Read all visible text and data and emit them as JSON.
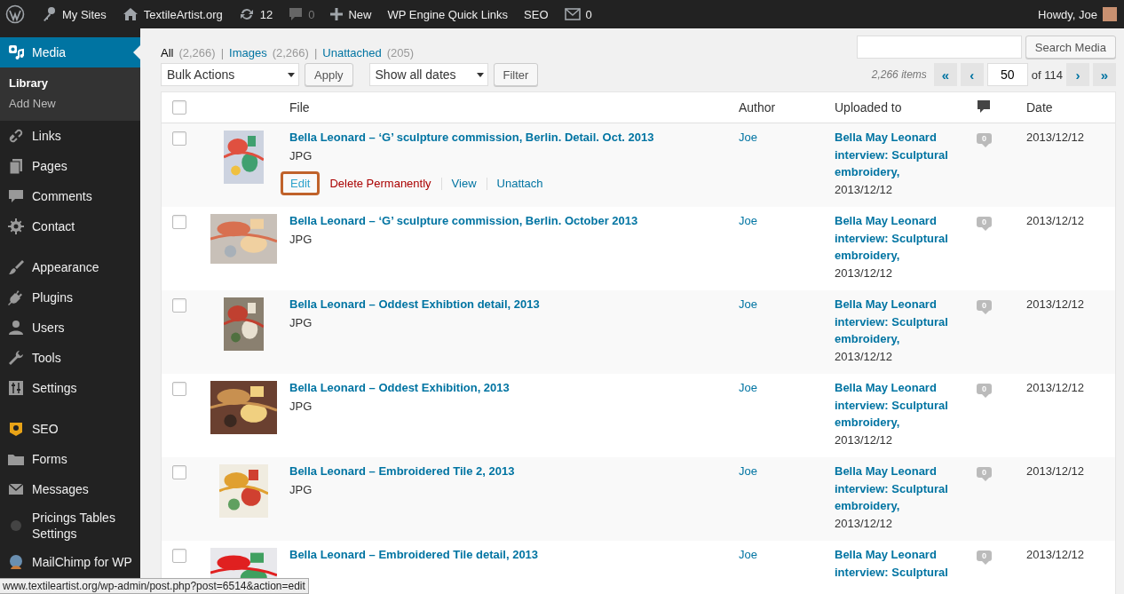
{
  "admin_bar": {
    "items": [
      {
        "kind": "wp-logo"
      },
      {
        "kind": "sites",
        "label": "My Sites"
      },
      {
        "kind": "home",
        "label": "TextileArtist.org"
      },
      {
        "kind": "updates",
        "label": "12"
      },
      {
        "kind": "comments",
        "label": "0"
      },
      {
        "kind": "new",
        "label": "New"
      },
      {
        "kind": "plain",
        "label": "WP Engine Quick Links"
      },
      {
        "kind": "plain",
        "label": "SEO"
      },
      {
        "kind": "mail",
        "label": "0"
      }
    ],
    "greeting": "Howdy, Joe"
  },
  "sidebar": {
    "groups": [
      [
        {
          "kind": "media",
          "label": "Media",
          "selected": true,
          "children": [
            {
              "label": "Library",
              "selected": true
            },
            {
              "label": "Add New",
              "selected": false
            }
          ]
        },
        {
          "kind": "links",
          "label": "Links",
          "selected": false
        },
        {
          "kind": "pages",
          "label": "Pages",
          "selected": false
        },
        {
          "kind": "comments",
          "label": "Comments",
          "selected": false
        },
        {
          "kind": "contact",
          "label": "Contact",
          "selected": false
        }
      ],
      [
        {
          "kind": "appearance",
          "label": "Appearance",
          "selected": false
        },
        {
          "kind": "plugins",
          "label": "Plugins",
          "selected": false
        },
        {
          "kind": "users",
          "label": "Users",
          "selected": false
        },
        {
          "kind": "tools",
          "label": "Tools",
          "selected": false
        },
        {
          "kind": "settings",
          "label": "Settings",
          "selected": false
        }
      ],
      [
        {
          "kind": "seo",
          "label": "SEO",
          "selected": false
        },
        {
          "kind": "forms",
          "label": "Forms",
          "selected": false
        },
        {
          "kind": "messages",
          "label": "Messages",
          "selected": false
        },
        {
          "kind": "pricing",
          "label": "Pricings Tables Settings",
          "selected": false
        },
        {
          "kind": "mailchimp",
          "label": "MailChimp for WP",
          "selected": false
        }
      ]
    ]
  },
  "views": [
    {
      "label": "All",
      "count": "(2,266)",
      "selected": true
    },
    {
      "separator": "|",
      "label": "Images",
      "count": "(2,266)",
      "selected": false
    },
    {
      "separator": "|",
      "label": "Unattached",
      "count": "(205)",
      "selected": false
    }
  ],
  "search": {
    "button": "Search Media"
  },
  "toolbar": {
    "bulk_actions": "Bulk Actions",
    "apply": "Apply",
    "dates": "Show all dates",
    "filter": "Filter"
  },
  "pagination": {
    "items": "2,266 items",
    "first": "«",
    "prev": "‹",
    "page": "50",
    "of": "of 114",
    "next": "›",
    "last": "»"
  },
  "table": {
    "select_all_checked": false,
    "columns": [
      "File",
      "Author",
      "Uploaded to",
      "Date"
    ],
    "rows": [
      {
        "checked": false,
        "title": "Bella Leonard – ‘G’ sculpture commission, Berlin. Detail. Oct. 2013",
        "type": "JPG",
        "actions": [
          {
            "kind": "edit",
            "label": "Edit",
            "focused": true
          },
          {
            "kind": "delete",
            "label": "Delete Permanently",
            "focused": false
          },
          {
            "kind": "link",
            "label": "View",
            "focused": false
          },
          {
            "kind": "link",
            "label": "Unattach",
            "focused": false
          }
        ],
        "author": "Joe",
        "uploaded_to": "Bella May Leonard interview: Sculptural embroidery,",
        "uploaded_date": "2013/12/12",
        "comments": "0",
        "date": "2013/12/12"
      },
      {
        "checked": false,
        "title": "Bella Leonard – ‘G’ sculpture commission, Berlin. October 2013",
        "type": "JPG",
        "author": "Joe",
        "uploaded_to": "Bella May Leonard interview: Sculptural embroidery,",
        "uploaded_date": "2013/12/12",
        "comments": "0",
        "date": "2013/12/12"
      },
      {
        "checked": false,
        "title": "Bella Leonard – Oddest Exhibtion detail, 2013",
        "type": "JPG",
        "author": "Joe",
        "uploaded_to": "Bella May Leonard interview: Sculptural embroidery,",
        "uploaded_date": "2013/12/12",
        "comments": "0",
        "date": "2013/12/12"
      },
      {
        "checked": false,
        "title": "Bella Leonard – Oddest Exhibition, 2013",
        "type": "JPG",
        "author": "Joe",
        "uploaded_to": "Bella May Leonard interview: Sculptural embroidery,",
        "uploaded_date": "2013/12/12",
        "comments": "0",
        "date": "2013/12/12"
      },
      {
        "checked": false,
        "title": "Bella Leonard – Embroidered Tile 2, 2013",
        "type": "JPG",
        "author": "Joe",
        "uploaded_to": "Bella May Leonard interview: Sculptural embroidery,",
        "uploaded_date": "2013/12/12",
        "comments": "0",
        "date": "2013/12/12"
      },
      {
        "checked": false,
        "title": "Bella Leonard – Embroidered Tile detail, 2013",
        "author": "Joe",
        "uploaded_to": "Bella May Leonard interview: Sculptural",
        "comments": "0",
        "date": "2013/12/12"
      }
    ]
  },
  "status_url": "www.textileartist.org/wp-admin/post.php?post=6514&action=edit"
}
